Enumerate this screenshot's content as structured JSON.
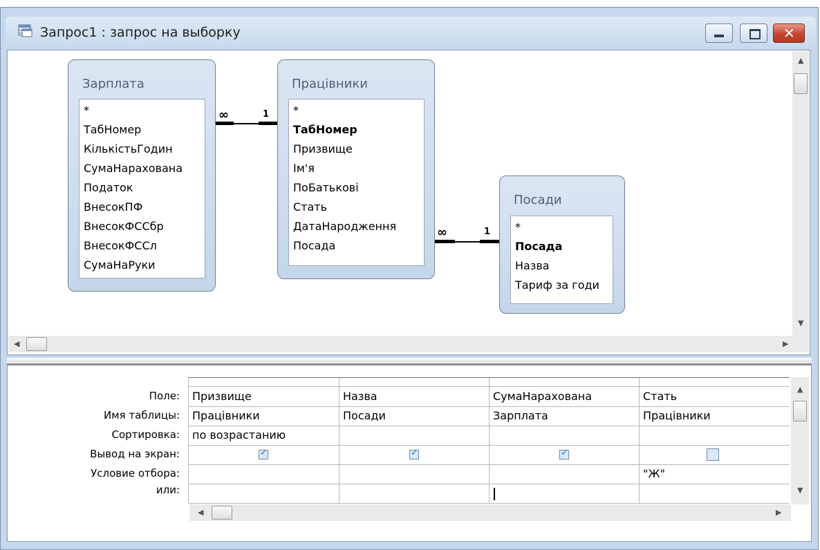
{
  "window": {
    "title": "Запрос1 : запрос на выборку",
    "icon": "query-icon",
    "controls": [
      "minimize",
      "maximize",
      "close"
    ]
  },
  "tables": [
    {
      "name": "Зарплата",
      "fields": [
        "*",
        "ТабНомер",
        "КількістьГодин",
        "СумаНарахована",
        "Податок",
        "ВнесокПФ",
        "ВнесокФССбр",
        "ВнесокФССл",
        "СумаНаРуки"
      ]
    },
    {
      "name": "Працівники",
      "fields": [
        "*",
        "ТабНомер",
        "Призвище",
        "Ім'я",
        "ПоБатькові",
        "Стать",
        "ДатаНародження",
        "Посада"
      ],
      "key_field": "ТабНомер"
    },
    {
      "name": "Посади",
      "fields": [
        "*",
        "Посада",
        "Назва",
        "Тариф за годи"
      ],
      "key_field": "Посада"
    }
  ],
  "relations": [
    {
      "many_label": "∞",
      "one_label": "1"
    },
    {
      "many_label": "∞",
      "one_label": "1"
    }
  ],
  "grid": {
    "row_labels": [
      "Поле:",
      "Имя таблицы:",
      "Сортировка:",
      "Вывод на экран:",
      "Условие отбора:",
      "или:"
    ],
    "columns": [
      {
        "field": "Призвище",
        "table": "Працівники",
        "sort": "по возрастанию",
        "show": true,
        "criteria": "",
        "or": ""
      },
      {
        "field": "Назва",
        "table": "Посади",
        "sort": "",
        "show": true,
        "criteria": "",
        "or": ""
      },
      {
        "field": "СумаНарахована",
        "table": "Зарплата",
        "sort": "",
        "show": true,
        "criteria": "",
        "or": ""
      },
      {
        "field": "Стать",
        "table": "Працівники",
        "sort": "",
        "show": false,
        "criteria": "\"Ж\"",
        "or": ""
      }
    ]
  }
}
